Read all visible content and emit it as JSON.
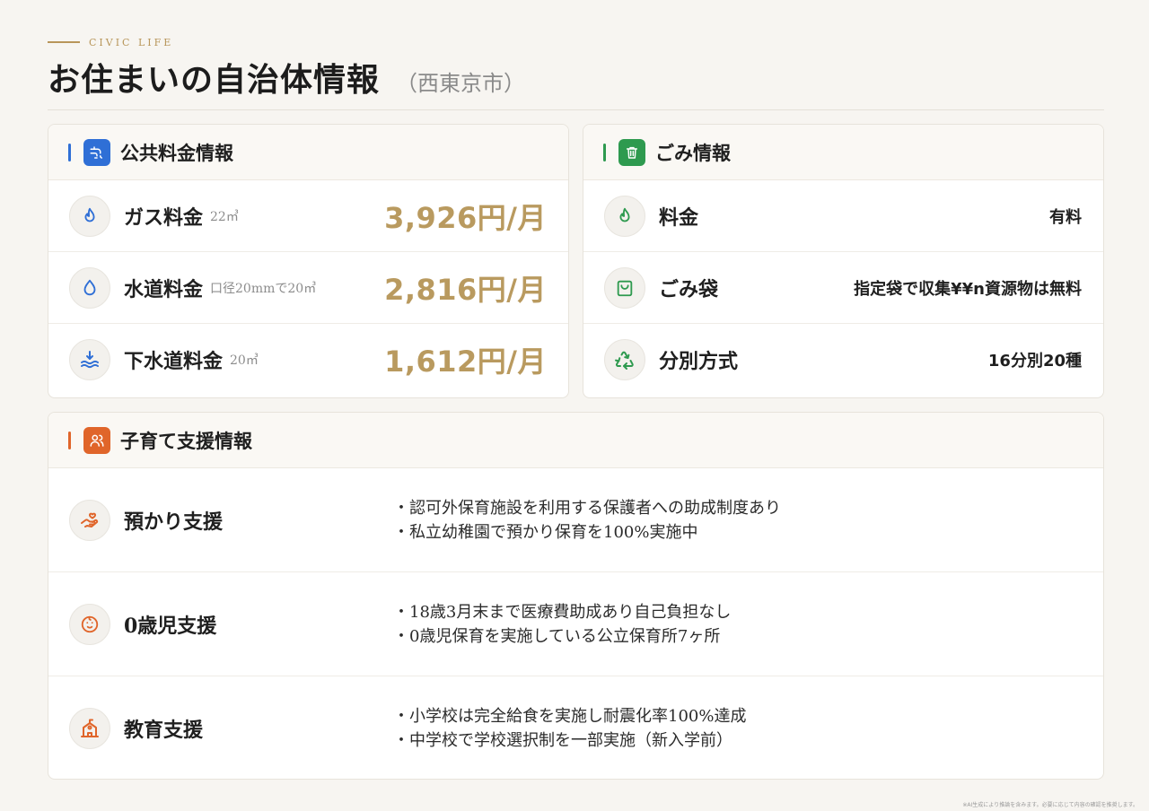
{
  "header": {
    "eyebrow": "CIVIC LIFE",
    "title": "お住まいの自治体情報",
    "city": "（西東京市）"
  },
  "utilities": {
    "title": "公共料金情報",
    "accent": "#2f6fd6",
    "items": [
      {
        "label": "ガス料金",
        "note": "22㎥",
        "value": "3,926円/月",
        "icon": "flame-icon"
      },
      {
        "label": "水道料金",
        "note": "口径20mmで20㎥",
        "value": "2,816円/月",
        "icon": "water-drop-icon"
      },
      {
        "label": "下水道料金",
        "note": "20㎥",
        "value": "1,612円/月",
        "icon": "sewage-icon"
      }
    ]
  },
  "garbage": {
    "title": "ごみ情報",
    "accent": "#2e9a4f",
    "items": [
      {
        "label": "料金",
        "value": "有料",
        "icon": "flame-icon"
      },
      {
        "label": "ごみ袋",
        "value": "指定袋で収集¥¥n資源物は無料",
        "icon": "bag-icon"
      },
      {
        "label": "分別方式",
        "value": "16分別20種",
        "icon": "recycle-icon"
      }
    ]
  },
  "childcare": {
    "title": "子育て支援情報",
    "accent": "#e0652a",
    "items": [
      {
        "label": "預かり支援",
        "icon": "hand-heart-icon",
        "points": [
          "認可外保育施設を利用する保護者への助成制度あり",
          "私立幼稚園で預かり保育を100%実施中"
        ]
      },
      {
        "label": "0歳児支援",
        "icon": "baby-icon",
        "points": [
          "18歳3月末まで医療費助成あり自己負担なし",
          "0歳児保育を実施している公立保育所7ヶ所"
        ]
      },
      {
        "label": "教育支援",
        "icon": "school-icon",
        "points": [
          "小学校は完全給食を実施し耐震化率100%達成",
          "中学校で学校選択制を一部実施（新入学前）"
        ]
      }
    ]
  },
  "footer": {
    "disclaimer": "※AI生成により推論を含みます。必要に応じて内容の確認を推奨します。"
  }
}
